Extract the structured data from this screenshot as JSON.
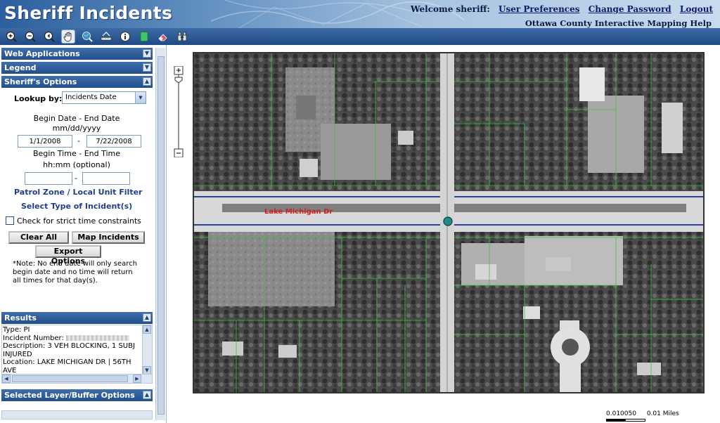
{
  "app": {
    "title": "Sheriff Incidents",
    "welcome": "Welcome sheriff:",
    "user_preferences": "User Preferences",
    "change_password": "Change Password",
    "logout": "Logout",
    "help": "Ottawa County Interactive Mapping Help"
  },
  "toolbar": {
    "tools": [
      "zoom-in-icon",
      "zoom-out-icon",
      "back-icon",
      "pan-hand-icon",
      "identify-globe-icon",
      "measure-icon",
      "info-icon",
      "select-icon",
      "eraser-icon",
      "binoculars-icon"
    ]
  },
  "panels": {
    "web_apps": "Web Applications",
    "legend": "Legend",
    "sheriff_options": "Sheriff's Options",
    "results": "Results",
    "selected_layer": "Selected Layer/Buffer Options"
  },
  "form": {
    "lookup_label": "Lookup by:",
    "lookup_value": "Incidents Date",
    "date_label": "Begin Date - End Date",
    "date_format": "mm/dd/yyyy",
    "begin_date": "1/1/2008",
    "end_date": "7/22/2008",
    "dash": "-",
    "time_label": "Begin Time - End Time",
    "time_format": "hh:mm (optional)",
    "begin_time": "",
    "end_time": "",
    "patrol_zone": "Patrol Zone / Local Unit Filter",
    "select_type": "Select Type of Incident(s)",
    "strict_time": "Check for strict time constraints",
    "clear_all": "Clear All",
    "map_incidents": "Map Incidents",
    "export_options": "Export Options",
    "note": "*Note: No end date will only search begin date and no time will return all times for that day(s)."
  },
  "results": {
    "type": "Type: PI",
    "incident_number_label": "Incident Number:",
    "description": "Description: 3 VEH BLOCKING, 1 SUBJ INJURED",
    "location": "Location: LAKE MICHIGAN DR | 56TH AVE"
  },
  "map": {
    "street_label": "Lake Michigan Dr",
    "scale_left": "0.010050",
    "scale_right": "0.01 Miles",
    "marker_color": "#1f8c8c",
    "parcel_color": "#39c739",
    "street_line_color": "#2b3f9e"
  }
}
